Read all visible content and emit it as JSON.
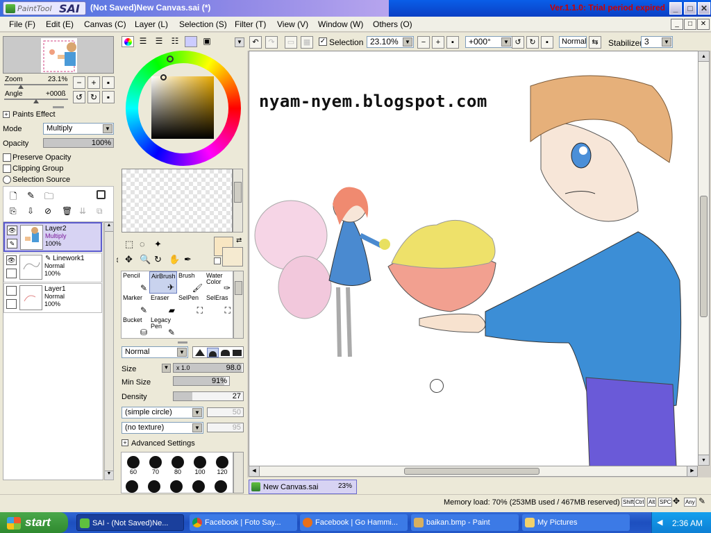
{
  "window": {
    "logo_brand": "PaintTool",
    "logo_name": "SAI",
    "title": "(Not Saved)New Canvas.sai (*)",
    "version": "Ver.1.1.0: Trial period expired"
  },
  "menu": [
    "File (F)",
    "Edit (E)",
    "Canvas (C)",
    "Layer (L)",
    "Selection (S)",
    "Filter (T)",
    "View (V)",
    "Window (W)",
    "Others (O)"
  ],
  "navigator": {
    "zoom_label": "Zoom",
    "zoom_value": "23.1%",
    "angle_label": "Angle",
    "angle_value": "+000ß"
  },
  "layer_props": {
    "paints_effect": "Paints Effect",
    "mode_label": "Mode",
    "mode_value": "Multiply",
    "opacity_label": "Opacity",
    "opacity_value": "100%",
    "preserve_opacity": "Preserve Opacity",
    "clipping_group": "Clipping Group",
    "selection_source": "Selection Source"
  },
  "layers": [
    {
      "name": "Layer2",
      "mode": "Multiply",
      "opacity": "100%",
      "selected": true
    },
    {
      "name": "Linework1",
      "mode": "Normal",
      "opacity": "100%",
      "selected": false
    },
    {
      "name": "Layer1",
      "mode": "Normal",
      "opacity": "100%",
      "selected": false
    }
  ],
  "tools": [
    {
      "label": "Pencil"
    },
    {
      "label": "AirBrush"
    },
    {
      "label": "Brush"
    },
    {
      "label": "Water Color"
    },
    {
      "label": "Marker"
    },
    {
      "label": "Eraser"
    },
    {
      "label": "SelPen"
    },
    {
      "label": "SelEras"
    },
    {
      "label": "Bucket"
    },
    {
      "label": "Legacy Pen"
    }
  ],
  "brush_settings": {
    "blend_mode": "Normal",
    "size_label": "Size",
    "size_mult": "x 1.0",
    "size_value": "98.0",
    "min_size_label": "Min Size",
    "min_size_value": "91%",
    "density_label": "Density",
    "density_value": "27",
    "shape": "(simple circle)",
    "shape_value": "50",
    "texture": "(no texture)",
    "texture_value": "95",
    "advanced": "Advanced Settings",
    "brush_sizes": [
      "60",
      "70",
      "80",
      "100",
      "120"
    ]
  },
  "toolbar": {
    "selection_label": "Selection",
    "zoom": "23.10%",
    "angle": "+000°",
    "blend": "Normal",
    "stabilizer_label": "Stabilizer",
    "stabilizer_value": "3"
  },
  "canvas": {
    "watermark": "nyam-nyem.blogspot.com"
  },
  "doc_tab": {
    "name": "New Canvas.sai",
    "zoom": "23%"
  },
  "statusbar": {
    "memory": "Memory load: 70% (253MB used / 467MB reserved)",
    "keys": [
      "Shift",
      "Ctrl",
      "Alt",
      "SPC",
      "Any"
    ]
  },
  "taskbar": {
    "start": "start",
    "tasks": [
      "SAI - (Not Saved)Ne...",
      "Facebook | Foto Say...",
      "Facebook | Go Hammi...",
      "baikan.bmp - Paint",
      "My Pictures"
    ],
    "clock": "2:36 AM"
  },
  "colors": {
    "title_bar": "#3c6de0",
    "selected_layer": "#d7d3f3",
    "canvas_bg": "#ffffff",
    "panel_bg": "#ece9d8",
    "taskbar": "#1d4fbf"
  }
}
